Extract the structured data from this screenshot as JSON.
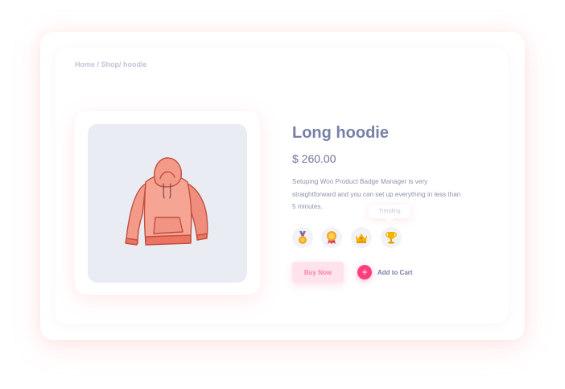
{
  "breadcrumb": "Home / Shop/ hoodie",
  "product": {
    "title": "Long hoodie",
    "price": "$ 260.00",
    "description": "Setuping Woo Product Badge Manager is very straightforward and you can set up everything in less than 5 minutes.",
    "image_icon": "hoodie-image"
  },
  "tooltip": "Trending",
  "badges": [
    {
      "icon": "medal-icon"
    },
    {
      "icon": "award-ribbon-icon"
    },
    {
      "icon": "crown-icon"
    },
    {
      "icon": "trophy-icon"
    }
  ],
  "actions": {
    "buy_now": "Buy Now",
    "add_to_cart": "Add to Cart",
    "add_icon": "+"
  },
  "colors": {
    "accent": "#ff3d7f",
    "title": "#7780a8",
    "hoodie": "#f58a7a",
    "image_bg": "#e9edf3"
  }
}
